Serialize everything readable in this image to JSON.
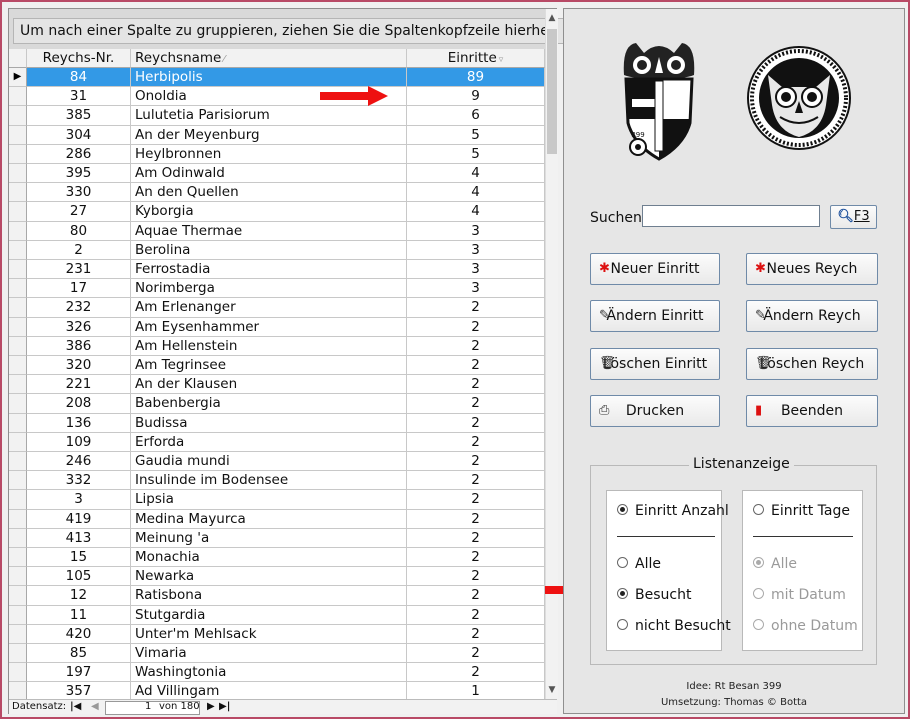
{
  "grid": {
    "group_hint": "Um nach einer Spalte zu gruppieren, ziehen Sie die Spaltenkopfzeile hierher.",
    "columns": [
      "Reychs-Nr.",
      "Reychsname",
      "Einritte"
    ],
    "rows": [
      {
        "nr": "84",
        "name": "Herbipolis",
        "einritte": "89"
      },
      {
        "nr": "31",
        "name": "Onoldia",
        "einritte": "9"
      },
      {
        "nr": "385",
        "name": "Lulutetia Parisiorum",
        "einritte": "6"
      },
      {
        "nr": "304",
        "name": "An der Meyenburg",
        "einritte": "5"
      },
      {
        "nr": "286",
        "name": "Heylbronnen",
        "einritte": "5"
      },
      {
        "nr": "395",
        "name": "Am Odinwald",
        "einritte": "4"
      },
      {
        "nr": "330",
        "name": "An den Quellen",
        "einritte": "4"
      },
      {
        "nr": "27",
        "name": "Kyborgia",
        "einritte": "4"
      },
      {
        "nr": "80",
        "name": "Aquae Thermae",
        "einritte": "3"
      },
      {
        "nr": "2",
        "name": "Berolina",
        "einritte": "3"
      },
      {
        "nr": "231",
        "name": "Ferrostadia",
        "einritte": "3"
      },
      {
        "nr": "17",
        "name": "Norimberga",
        "einritte": "3"
      },
      {
        "nr": "232",
        "name": "Am Erlenanger",
        "einritte": "2"
      },
      {
        "nr": "326",
        "name": "Am Eysenhammer",
        "einritte": "2"
      },
      {
        "nr": "386",
        "name": "Am Hellenstein",
        "einritte": "2"
      },
      {
        "nr": "320",
        "name": "Am Tegrinsee",
        "einritte": "2"
      },
      {
        "nr": "221",
        "name": "An der Klausen",
        "einritte": "2"
      },
      {
        "nr": "208",
        "name": "Babenbergia",
        "einritte": "2"
      },
      {
        "nr": "136",
        "name": "Budissa",
        "einritte": "2"
      },
      {
        "nr": "109",
        "name": "Erforda",
        "einritte": "2"
      },
      {
        "nr": "246",
        "name": "Gaudia mundi",
        "einritte": "2"
      },
      {
        "nr": "332",
        "name": "Insulinde im Bodensee",
        "einritte": "2"
      },
      {
        "nr": "3",
        "name": "Lipsia",
        "einritte": "2"
      },
      {
        "nr": "419",
        "name": "Medina Mayurca",
        "einritte": "2"
      },
      {
        "nr": "413",
        "name": "Meinung 'a",
        "einritte": "2"
      },
      {
        "nr": "15",
        "name": "Monachia",
        "einritte": "2"
      },
      {
        "nr": "105",
        "name": "Newarka",
        "einritte": "2"
      },
      {
        "nr": "12",
        "name": "Ratisbona",
        "einritte": "2"
      },
      {
        "nr": "11",
        "name": "Stutgardia",
        "einritte": "2"
      },
      {
        "nr": "420",
        "name": "Unter'm Mehlsack",
        "einritte": "2"
      },
      {
        "nr": "85",
        "name": "Vimaria",
        "einritte": "2"
      },
      {
        "nr": "197",
        "name": "Washingtonia",
        "einritte": "2"
      },
      {
        "nr": "357",
        "name": "Ad Villingam",
        "einritte": "1"
      }
    ]
  },
  "nav": {
    "label": "Datensatz:",
    "current": "1",
    "of_label": "von 180"
  },
  "search": {
    "label": "Suchen",
    "value": "",
    "button_label": "F3"
  },
  "buttons": {
    "neuer_einritt": "Neuer Einritt",
    "neues_reych": "Neues Reych",
    "aendern_einritt": "Ändern Einritt",
    "aendern_reych": "Ändern Reych",
    "loeschen_einritt": "Löschen Einritt",
    "loeschen_reych": "Löschen Reych",
    "drucken": "Drucken",
    "beenden": "Beenden"
  },
  "liste": {
    "title": "Listenanzeige",
    "left_header": "Einritt Anzahl",
    "right_header": "Einritt Tage",
    "left_options": [
      "Alle",
      "Besucht",
      "nicht Besucht"
    ],
    "right_options": [
      "Alle",
      "mit Datum",
      "ohne Datum"
    ],
    "left_selected": "Besucht",
    "right_selected": "Alle"
  },
  "emblem": {
    "shield_number": "399"
  },
  "credits": {
    "idee": "Idee: Rt Besan 399",
    "umsetzung": "Umsetzung: Thomas © Botta"
  },
  "colors": {
    "selection": "#3399e6",
    "arrow": "#ee1111"
  }
}
